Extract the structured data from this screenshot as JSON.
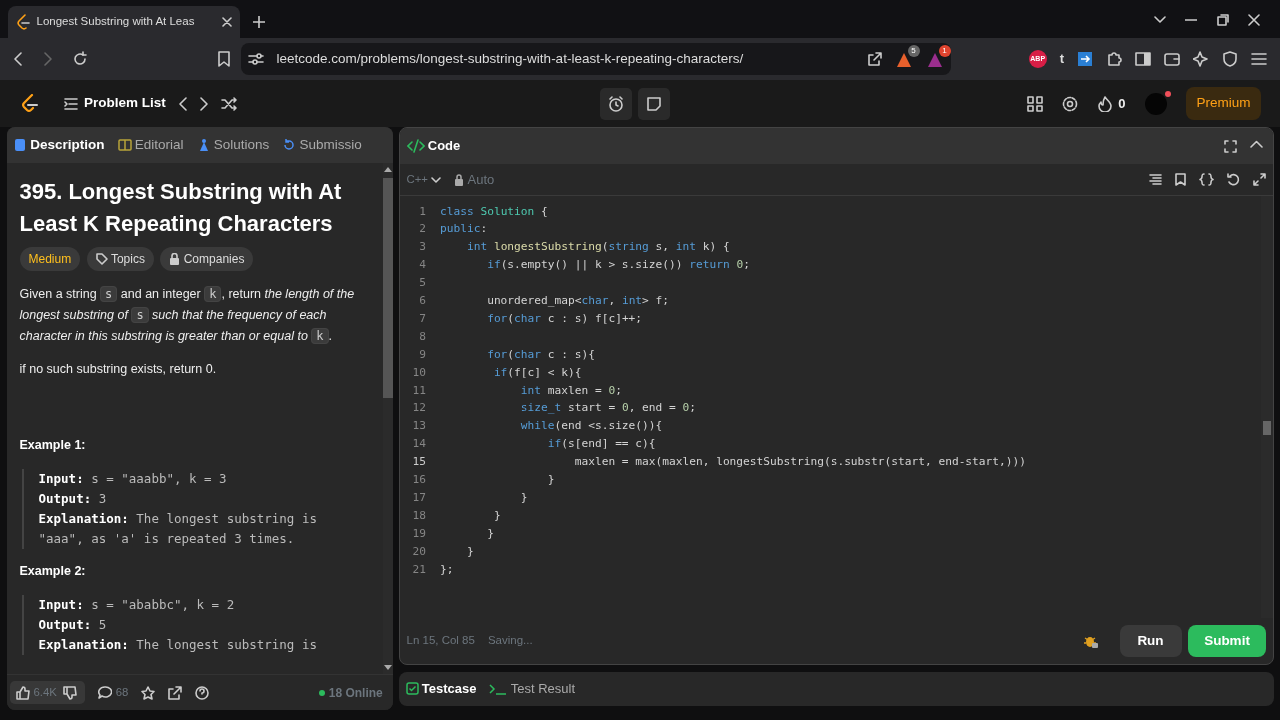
{
  "browser": {
    "tab_title": "Longest Substring with At Leas",
    "url": "leetcode.com/problems/longest-substring-with-at-least-k-repeating-characters/",
    "shield_count": "5",
    "alert_count": "1",
    "ext_label": "ABP",
    "ext_t": "t"
  },
  "nav": {
    "problem_list": "Problem List",
    "streak": "0",
    "premium": "Premium"
  },
  "left_tabs": [
    {
      "label": "Description",
      "selected": true
    },
    {
      "label": "Editorial",
      "selected": false
    },
    {
      "label": "Solutions",
      "selected": false
    },
    {
      "label": "Submissio",
      "selected": false
    }
  ],
  "problem": {
    "title": "395. Longest Substring with At Least K Repeating Characters",
    "difficulty": "Medium",
    "tags": [
      "Topics",
      "Companies"
    ],
    "description": [
      {
        "kind": "text",
        "text": "Given a string "
      },
      {
        "kind": "code",
        "text": "s"
      },
      {
        "kind": "text",
        "text": " and an integer "
      },
      {
        "kind": "code",
        "text": "k"
      },
      {
        "kind": "text",
        "text": ", return "
      },
      {
        "kind": "italic",
        "text": "the length of the longest substring of "
      },
      {
        "kind": "code",
        "text": "s"
      },
      {
        "kind": "italic",
        "text": " such that the frequency of each character in this substring is greater than or equal to "
      },
      {
        "kind": "code",
        "text": "k"
      },
      {
        "kind": "text",
        "text": "."
      }
    ],
    "note": "if no such substring exists, return 0.",
    "examples": [
      {
        "title": "Example 1:",
        "lines": [
          {
            "label": "Input:",
            "text": "s = \"aaabb\", k = 3"
          },
          {
            "label": "Output:",
            "text": "3"
          },
          {
            "label": "Explanation:",
            "text": "The longest substring is \"aaa\", as 'a' is repeated 3 times."
          }
        ]
      },
      {
        "title": "Example 2:",
        "lines": [
          {
            "label": "Input:",
            "text": "s = \"ababbc\", k = 2"
          },
          {
            "label": "Output:",
            "text": "5"
          },
          {
            "label": "Explanation:",
            "text": "The longest substring is"
          }
        ]
      }
    ]
  },
  "footer": {
    "likes": "6.4K",
    "comments": "68",
    "online": "18 Online"
  },
  "editor": {
    "title": "Code",
    "language": "C++",
    "mode": "Auto",
    "lines": [
      {
        "n": "1",
        "tokens": [
          {
            "kind": "kw",
            "text": "class"
          },
          {
            "kind": "type",
            "text": " Solution"
          },
          {
            "kind": "plain",
            "text": " {"
          }
        ]
      },
      {
        "n": "2",
        "tokens": [
          {
            "kind": "kw",
            "text": "public"
          },
          {
            "kind": "plain",
            "text": ":"
          }
        ]
      },
      {
        "n": "3",
        "tokens": [
          {
            "kind": "kw",
            "text": "    int"
          },
          {
            "kind": "fn",
            "text": " longestSubstring"
          },
          {
            "kind": "plain",
            "text": "("
          },
          {
            "kind": "kw",
            "text": "string"
          },
          {
            "kind": "plain",
            "text": " s, "
          },
          {
            "kind": "kw",
            "text": "int"
          },
          {
            "kind": "plain",
            "text": " k) {"
          }
        ]
      },
      {
        "n": "4",
        "tokens": [
          {
            "kind": "kw",
            "text": "       if"
          },
          {
            "kind": "plain",
            "text": "(s.empty() || k > s.size()) "
          },
          {
            "kind": "kw",
            "text": "return"
          },
          {
            "kind": "num",
            "text": " 0"
          },
          {
            "kind": "plain",
            "text": ";"
          }
        ]
      },
      {
        "n": "5"
      },
      {
        "n": "6",
        "tokens": [
          {
            "kind": "plain",
            "text": "       unordered_map<"
          },
          {
            "kind": "kw",
            "text": "char"
          },
          {
            "kind": "plain",
            "text": ", "
          },
          {
            "kind": "kw",
            "text": "int"
          },
          {
            "kind": "plain",
            "text": "> f;"
          }
        ]
      },
      {
        "n": "7",
        "tokens": [
          {
            "kind": "kw",
            "text": "       for"
          },
          {
            "kind": "plain",
            "text": "("
          },
          {
            "kind": "kw",
            "text": "char"
          },
          {
            "kind": "plain",
            "text": " c : s) f[c]++;"
          }
        ]
      },
      {
        "n": "8"
      },
      {
        "n": "9",
        "tokens": [
          {
            "kind": "kw",
            "text": "       for"
          },
          {
            "kind": "plain",
            "text": "("
          },
          {
            "kind": "kw",
            "text": "char"
          },
          {
            "kind": "plain",
            "text": " c : s){"
          }
        ]
      },
      {
        "n": "10",
        "tokens": [
          {
            "kind": "kw",
            "text": "        if"
          },
          {
            "kind": "plain",
            "text": "(f[c] < k){"
          }
        ]
      },
      {
        "n": "11",
        "tokens": [
          {
            "kind": "kw",
            "text": "            int"
          },
          {
            "kind": "plain",
            "text": " maxlen = "
          },
          {
            "kind": "num",
            "text": "0"
          },
          {
            "kind": "plain",
            "text": ";"
          }
        ]
      },
      {
        "n": "12",
        "tokens": [
          {
            "kind": "kw",
            "text": "            size_t"
          },
          {
            "kind": "plain",
            "text": " start = "
          },
          {
            "kind": "num",
            "text": "0"
          },
          {
            "kind": "plain",
            "text": ", end = "
          },
          {
            "kind": "num",
            "text": "0"
          },
          {
            "kind": "plain",
            "text": ";"
          }
        ]
      },
      {
        "n": "13",
        "tokens": [
          {
            "kind": "kw",
            "text": "            while"
          },
          {
            "kind": "plain",
            "text": "(end <s.size()){"
          }
        ]
      },
      {
        "n": "14",
        "tokens": [
          {
            "kind": "kw",
            "text": "                if"
          },
          {
            "kind": "plain",
            "text": "(s[end] == c){"
          }
        ]
      },
      {
        "n": "15",
        "current": true,
        "tokens": [
          {
            "kind": "plain",
            "text": "                    maxlen = max(maxlen, longestSubstring(s.substr(start, end-start,)))"
          }
        ]
      },
      {
        "n": "16",
        "tokens": [
          {
            "kind": "plain",
            "text": "                }"
          }
        ]
      },
      {
        "n": "17",
        "tokens": [
          {
            "kind": "plain",
            "text": "            }"
          }
        ]
      },
      {
        "n": "18",
        "tokens": [
          {
            "kind": "plain",
            "text": "        }"
          }
        ]
      },
      {
        "n": "19",
        "tokens": [
          {
            "kind": "plain",
            "text": "       }"
          }
        ]
      },
      {
        "n": "20",
        "tokens": [
          {
            "kind": "plain",
            "text": "    }"
          }
        ]
      },
      {
        "n": "21",
        "tokens": [
          {
            "kind": "plain",
            "text": "};"
          }
        ]
      }
    ],
    "cursor": "Ln 15, Col 85",
    "save_status": "Saving...",
    "run": "Run",
    "submit": "Submit"
  },
  "bottom_tabs": [
    {
      "label": "Testcase",
      "selected": true
    },
    {
      "label": "Test Result",
      "selected": false
    }
  ]
}
